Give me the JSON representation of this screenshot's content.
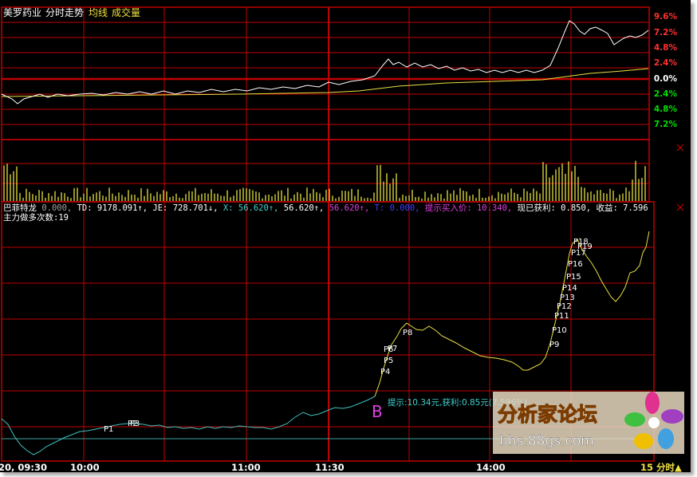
{
  "header": {
    "stock_name": "美罗药业",
    "view_name": "分时走势",
    "avg_line_label": "均线",
    "volume_label": "成交量"
  },
  "top_axis": {
    "labels": [
      "9.6%",
      "7.2%",
      "4.8%",
      "2.4%",
      "0.0%",
      "2.4%",
      "4.8%",
      "7.2%"
    ],
    "label_colors": [
      "#ff3030",
      "#ff3030",
      "#ff3030",
      "#ff3030",
      "#ffffff",
      "#00e000",
      "#00e000",
      "#00e000"
    ]
  },
  "indicator_bar": {
    "items": [
      {
        "text": "巴菲特龙",
        "color": "#ffffff"
      },
      {
        "text": "0.000,",
        "color": "#a0a0a0"
      },
      {
        "text": "TD: 9178.091↑,",
        "color": "#ffffff"
      },
      {
        "text": "JE: 728.701↓,",
        "color": "#ffffff"
      },
      {
        "text": "X: 56.620↑,",
        "color": "#40d0d0"
      },
      {
        "text": "56.620↑,",
        "color": "#ffffff"
      },
      {
        "text": "56.620↑,",
        "color": "#e040e0"
      },
      {
        "text": "T: 0.000,",
        "color": "#4040ff"
      },
      {
        "text": "提示买入价: 10.340,",
        "color": "#e040e0"
      },
      {
        "text": "现已获利: 0.850,",
        "color": "#ffffff"
      },
      {
        "text": "收益: 7.596",
        "color": "#ffffff"
      }
    ],
    "line2": "主力做多次数:19"
  },
  "signals": {
    "labels": [
      "P1",
      "P2",
      "P3",
      "P4",
      "P5",
      "P6",
      "P7",
      "P8",
      "P9",
      "P10",
      "P11",
      "P12",
      "P13",
      "P14",
      "P15",
      "P16",
      "P17",
      "P18",
      "P19"
    ],
    "buy_marker": "B",
    "tip": "提示:10.34元,获利:0.85元(7.596%)"
  },
  "time_axis": {
    "labels": [
      "20, 09:30",
      "10:00",
      "11:00",
      "11:30",
      "14:00",
      "15 分时▲"
    ]
  },
  "watermark": {
    "title": "分析家论坛",
    "url": "bbs.88gs.com"
  },
  "close_icons": [
    "close-icon",
    "close-icon"
  ],
  "colors": {
    "grid": "#c00000",
    "price_line": "#ffffff",
    "avg_line": "#e8e040",
    "volume": "#e8e040",
    "main_line": "#40c0c0"
  }
}
